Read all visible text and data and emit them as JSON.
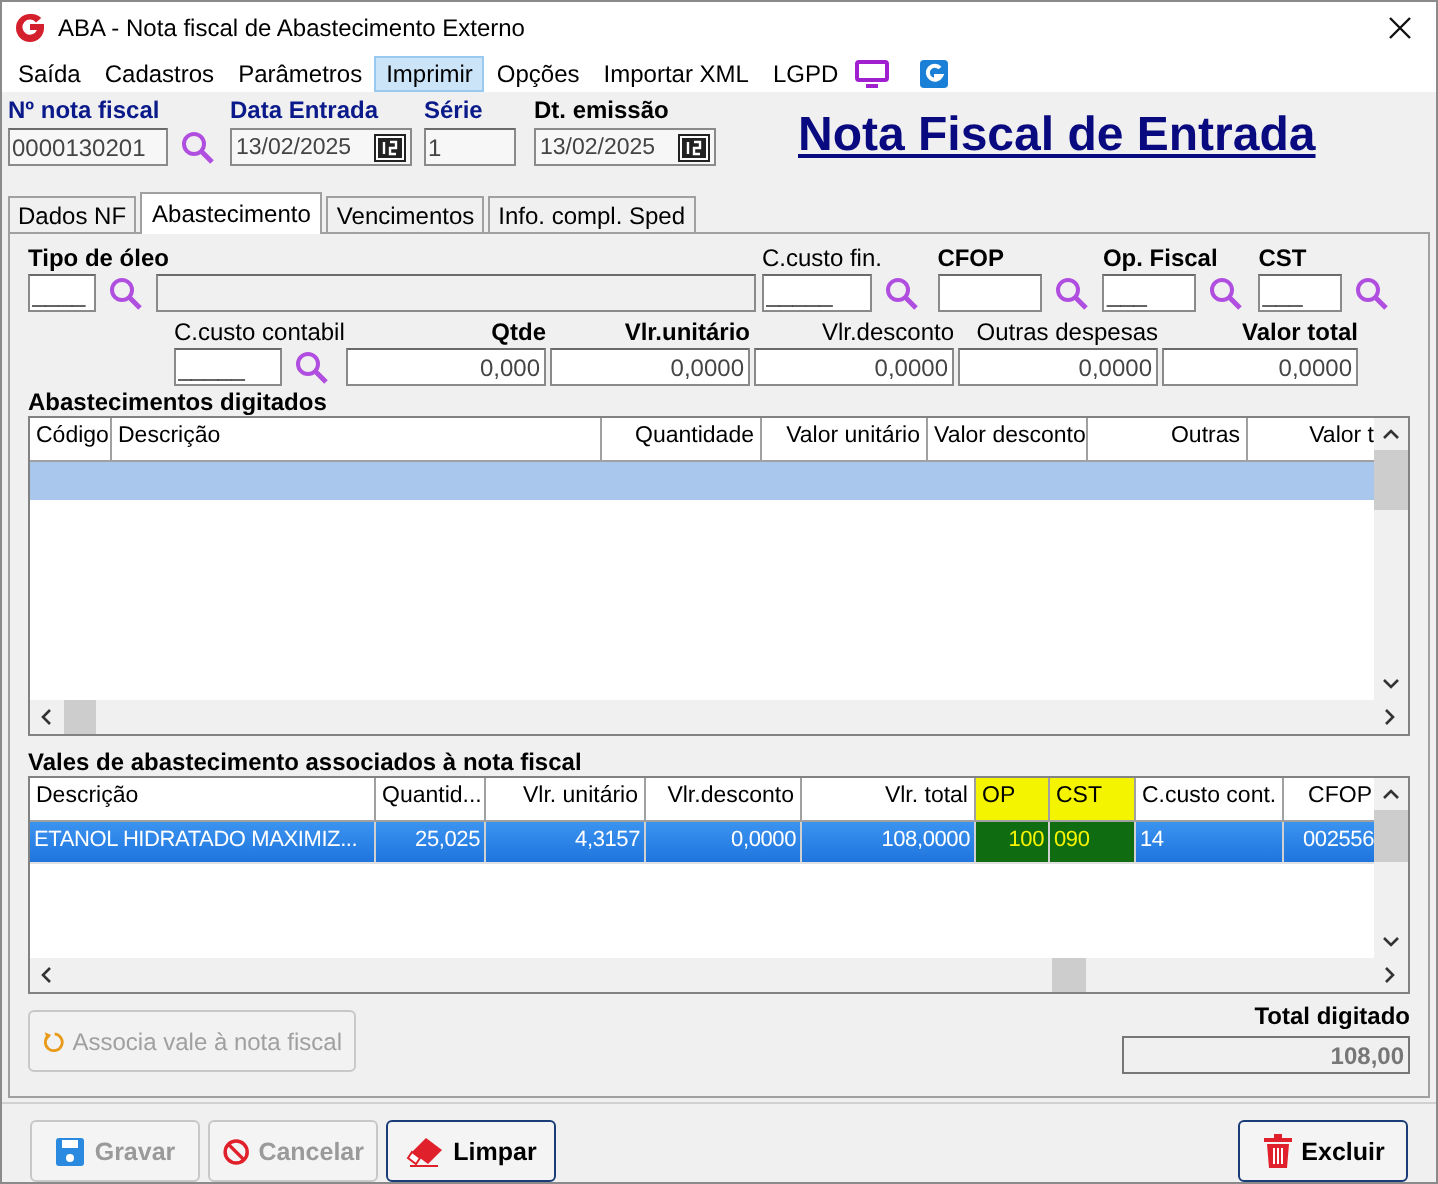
{
  "window": {
    "title": "ABA - Nota fiscal de Abastecimento Externo"
  },
  "menu": [
    {
      "label": "Saída",
      "selected": false
    },
    {
      "label": "Cadastros",
      "selected": false
    },
    {
      "label": "Parâmetros",
      "selected": false
    },
    {
      "label": "Imprimir",
      "selected": true
    },
    {
      "label": "Opções",
      "selected": false
    },
    {
      "label": "Importar XML",
      "selected": false
    },
    {
      "label": "LGPD",
      "selected": false
    }
  ],
  "header": {
    "fields": [
      {
        "label": "Nº nota fiscal",
        "value": "0000130201",
        "kind": "search",
        "highlight": true
      },
      {
        "label": "Data Entrada",
        "value": "13/02/2025",
        "kind": "date",
        "highlight": true
      },
      {
        "label": "Série",
        "value": "1",
        "kind": "plain",
        "highlight": true
      },
      {
        "label": "Dt. emissão",
        "value": "13/02/2025",
        "kind": "date",
        "highlight": false
      }
    ],
    "heading": "Nota Fiscal de Entrada"
  },
  "tabs": [
    {
      "label": "Dados NF",
      "selected": false
    },
    {
      "label": "Abastecimento",
      "selected": true
    },
    {
      "label": "Vencimentos",
      "selected": false
    },
    {
      "label": "Info. compl. Sped",
      "selected": false
    }
  ],
  "entry_form": {
    "row_1": [
      {
        "label": "Tipo de óleo",
        "value": "____",
        "kind": "lookup-desc",
        "bold": true
      },
      {
        "label": "C.custo fin.",
        "value": "_____",
        "kind": "lookup",
        "bold": false
      },
      {
        "label": "CFOP",
        "kind": "lookup",
        "bold": true
      },
      {
        "label": "Op. Fiscal",
        "value": "___",
        "kind": "lookup",
        "bold": true
      },
      {
        "label": "CST",
        "value": "___",
        "kind": "lookup",
        "bold": true
      }
    ],
    "row_2": [
      {
        "label": "C.custo contabil",
        "value": "_____",
        "kind": "lookup",
        "bold": false
      },
      {
        "label": "Qtde",
        "value": "0,000",
        "kind": "number",
        "bold": true
      },
      {
        "label": "Vlr.unitário",
        "value": "0,0000",
        "kind": "number",
        "bold": true
      },
      {
        "label": "Vlr.desconto",
        "value": "0,0000",
        "kind": "number",
        "bold": false
      },
      {
        "label": "Outras despesas",
        "value": "0,0000",
        "kind": "number",
        "bold": false
      },
      {
        "label": "Valor total",
        "value": "0,0000",
        "kind": "number",
        "bold": true
      }
    ]
  },
  "abastecimentos": {
    "title": "Abastecimentos digitados",
    "columns": [
      "Código",
      "Descrição",
      "Quantidade",
      "Valor unitário",
      "Valor desconto",
      "Outras",
      "Valor t"
    ],
    "rows": [
      {
        "selected": true
      }
    ]
  },
  "vales": {
    "title": "Vales de abastecimento associados à nota fiscal",
    "columns": [
      {
        "label": "Descrição",
        "highlight": false
      },
      {
        "label": "Quantid...",
        "highlight": false
      },
      {
        "label": "Vlr. unitário",
        "highlight": false
      },
      {
        "label": "Vlr.desconto",
        "highlight": false
      },
      {
        "label": "Vlr. total",
        "highlight": false
      },
      {
        "label": "OP",
        "highlight": true
      },
      {
        "label": "CST",
        "highlight": true
      },
      {
        "label": "C.custo cont.",
        "highlight": false
      },
      {
        "label": "CFOP",
        "highlight": false
      }
    ],
    "rows": [
      {
        "selected": true,
        "cells": [
          "ETANOL HIDRATADO MAXIMIZ...",
          "25,025",
          "4,3157",
          "0,0000",
          "108,0000",
          "100",
          "090",
          "14",
          "002556"
        ]
      }
    ]
  },
  "associate_button": {
    "label": "Associa vale à nota fiscal",
    "disabled": true
  },
  "total": {
    "label": "Total digitado",
    "value": "108,00"
  },
  "buttons": [
    {
      "label": "Gravar",
      "kind": "save",
      "disabled": true
    },
    {
      "label": "Cancelar",
      "kind": "cancel",
      "disabled": true
    },
    {
      "label": "Limpar",
      "kind": "clear",
      "disabled": false
    },
    {
      "label": "Excluir",
      "kind": "delete",
      "disabled": false
    }
  ]
}
